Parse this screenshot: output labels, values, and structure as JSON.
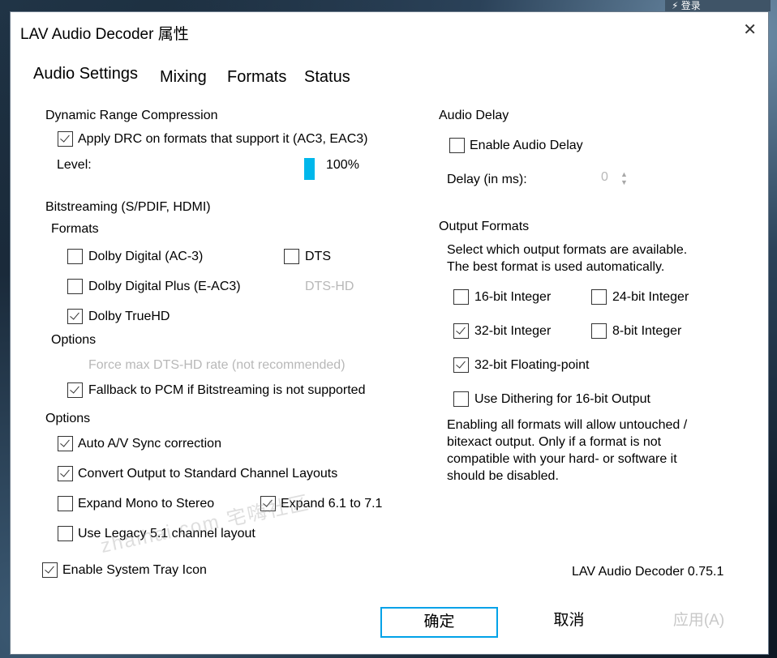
{
  "desktop": {
    "taskbar_text": "⚡ 登录"
  },
  "window": {
    "title": "LAV Audio Decoder 属性",
    "close_glyph": "✕"
  },
  "tabs": [
    "Audio Settings",
    "Mixing",
    "Formats",
    "Status"
  ],
  "drc": {
    "group": "Dynamic Range Compression",
    "apply_label": "Apply DRC on formats that support it (AC3, EAC3)",
    "apply_checked": true,
    "level_label": "Level:",
    "level_value": "100%",
    "level_percent": 100
  },
  "bitstreaming": {
    "group": "Bitstreaming (S/PDIF, HDMI)",
    "formats_label": "Formats",
    "dolby_digital": "Dolby Digital (AC-3)",
    "dts": "DTS",
    "dolby_digital_plus": "Dolby Digital Plus (E-AC3)",
    "dts_hd": "DTS-HD",
    "dolby_truehd": "Dolby TrueHD",
    "options_label": "Options",
    "force_dtshd": "Force max DTS-HD rate (not recommended)",
    "fallback_pcm": "Fallback to PCM if Bitstreaming is not supported"
  },
  "options": {
    "group": "Options",
    "auto_av": "Auto A/V Sync correction",
    "convert_output": "Convert Output to Standard Channel Layouts",
    "expand_mono": "Expand Mono to Stereo",
    "expand_61": "Expand 6.1 to 7.1",
    "legacy_51": "Use Legacy 5.1 channel layout"
  },
  "tray": {
    "label": "Enable System Tray Icon"
  },
  "audio_delay": {
    "group": "Audio Delay",
    "enable_label": "Enable Audio Delay",
    "delay_label": "Delay (in ms):",
    "delay_value": "0",
    "spin_up": "▲",
    "spin_down": "▼"
  },
  "output_formats": {
    "group": "Output Formats",
    "desc_line1": "Select which output formats are available.",
    "desc_line2": "The best format is used automatically.",
    "int16": "16-bit Integer",
    "int24": "24-bit Integer",
    "int32": "32-bit Integer",
    "int8": "8-bit Integer",
    "float32": "32-bit Floating-point",
    "dither16": "Use Dithering for 16-bit Output",
    "note_line1": "Enabling all formats will allow untouched /",
    "note_line2": "bitexact output. Only if a format is not",
    "note_line3": "compatible with your hard- or software it",
    "note_line4": "should be disabled."
  },
  "version": "LAV Audio Decoder 0.75.1",
  "buttons": {
    "ok": "确定",
    "cancel": "取消",
    "apply": "应用(A)"
  },
  "watermark": "zhaihai.com 宅嗨社区",
  "colors": {
    "accent": "#00b7eb",
    "primary_border": "#00a2e8",
    "disabled_text": "#b8b8b8"
  }
}
